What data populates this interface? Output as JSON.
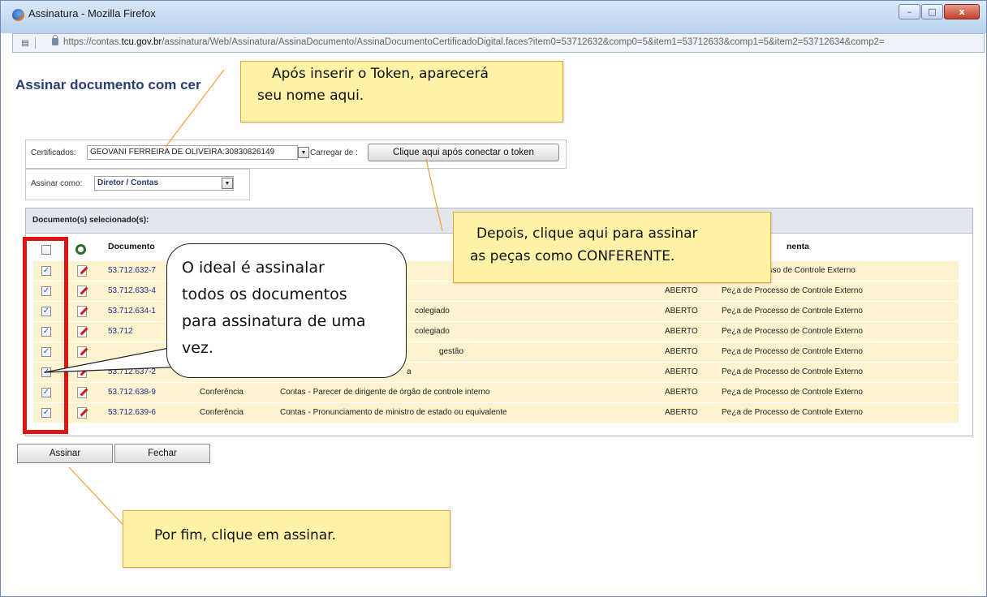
{
  "window": {
    "title": "Assinatura - Mozilla Firefox",
    "buttons": [
      "–",
      "□",
      "x"
    ]
  },
  "browser": {
    "url_prefix": "https://contas.",
    "url_domain": "tcu.gov.br",
    "url_rest": "/assinatura/Web/Assinatura/AssinaDocumento/AssinaDocumentoCertificadoDigital.faces?item0=53712632&comp0=5&item1=53712633&comp1=5&item2=53712634&comp2="
  },
  "page": {
    "title": "Assinar documento com cer"
  },
  "certificados": {
    "label": "Certificados:",
    "value": "GEOVANI FERREIRA DE OLIVEIRA:30830826149",
    "carregar_label": "Carregar de :",
    "token_button": "Clique aqui após conectar o token"
  },
  "assinar_como": {
    "label": "Assinar como:",
    "value": "Diretor / Contas"
  },
  "panel": {
    "title": "Documento(s) selecionado(s):"
  },
  "columns": {
    "documento": "Documento",
    "ferramenta": "nenta"
  },
  "rows": [
    {
      "doc": "53.712.632-7",
      "tipo": "",
      "descricao": "",
      "situacao": "",
      "ferramenta": "esso de Controle Externo",
      "checked": true
    },
    {
      "doc": "53.712.633-4",
      "tipo": "",
      "descricao": "",
      "situacao": "ABERTO",
      "ferramenta": "Pe¿a de Processo de Controle Externo",
      "checked": true
    },
    {
      "doc": "53.712.634-1",
      "tipo": "",
      "descricao": "colegiado",
      "situacao": "ABERTO",
      "ferramenta": "Pe¿a de Processo de Controle Externo",
      "checked": true
    },
    {
      "doc": "53.712",
      "tipo": "",
      "descricao": "colegiado",
      "situacao": "ABERTO",
      "ferramenta": "Pe¿a de Processo de Controle Externo",
      "checked": true
    },
    {
      "doc": "",
      "tipo": "",
      "descricao": "gestão",
      "situacao": "ABERTO",
      "ferramenta": "Pe¿a de Processo de Controle Externo",
      "checked": true
    },
    {
      "doc": "53.712.637-2",
      "tipo": "",
      "descricao": "a",
      "situacao": "ABERTO",
      "ferramenta": "Pe¿a de Processo de Controle Externo",
      "checked": true
    },
    {
      "doc": "53.712.638-9",
      "tipo": "Conferência",
      "descricao": "Contas - Parecer de dirigente de órgão de controle interno",
      "situacao": "ABERTO",
      "ferramenta": "Pe¿a de Processo de Controle Externo",
      "checked": true
    },
    {
      "doc": "53.712.639-6",
      "tipo": "Conferência",
      "descricao": "Contas - Pronunciamento de ministro de estado ou equivalente",
      "situacao": "ABERTO",
      "ferramenta": "Pe¿a de Processo de Controle Externo",
      "checked": true
    }
  ],
  "buttons": {
    "assinar": "Assinar",
    "fechar": "Fechar"
  },
  "annotations": {
    "token_note_line1": "Após inserir o Token, aparecerá",
    "token_note_line2": "seu nome aqui.",
    "click_note_line1": "Depois, clique aqui para assinar",
    "click_note_line2": "as peças como CONFERENTE.",
    "final_note": "Por fim, clique em assinar.",
    "bubble_lines": [
      "O ideal é assinalar",
      "todos os documentos",
      "para assinatura de uma",
      "vez."
    ]
  },
  "colors": {
    "callout_bg": "#fdf2a6",
    "callout_border": "#e4a63a",
    "highlight_frame": "#e01616",
    "row_bg": "#fdf3cf",
    "heading": "#2c3e70"
  }
}
